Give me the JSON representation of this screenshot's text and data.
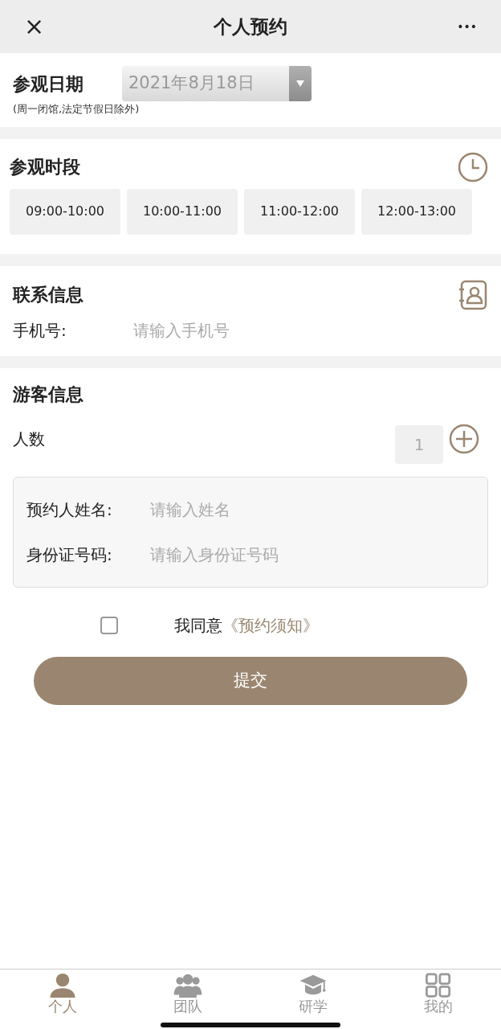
{
  "header": {
    "title": "个人预约",
    "close": "×",
    "more": "•••"
  },
  "date_section": {
    "title": "参观日期",
    "note": "(周一闭馆,法定节假日除外)",
    "value": "2021年8月18日"
  },
  "time_section": {
    "title": "参观时段",
    "slots": [
      {
        "label": "09:00-10:00",
        "selected": false
      },
      {
        "label": "10:00-11:00",
        "selected": false
      },
      {
        "label": "11:00-12:00",
        "selected": false
      },
      {
        "label": "12:00-13:00",
        "selected": false
      }
    ]
  },
  "contact_section": {
    "title": "联系信息",
    "phone_label": "手机号:",
    "phone_placeholder": "请输入手机号"
  },
  "visitor_section": {
    "title": "游客信息",
    "count_label": "人数",
    "count": "1",
    "fields": [
      {
        "label": "预约人姓名:",
        "placeholder": "请输入姓名"
      },
      {
        "label": "身份证号码:",
        "placeholder": "请输入身份证号码"
      }
    ]
  },
  "agreement": {
    "checked": false,
    "text": "我同意",
    "link": "《预约须知》"
  },
  "submit": "提交",
  "tabbar": [
    {
      "label": "个人",
      "kind": "person",
      "selected": true
    },
    {
      "label": "团队",
      "kind": "group",
      "selected": false
    },
    {
      "label": "研学",
      "kind": "study",
      "selected": false
    },
    {
      "label": "我的",
      "kind": "grid",
      "selected": false
    }
  ]
}
